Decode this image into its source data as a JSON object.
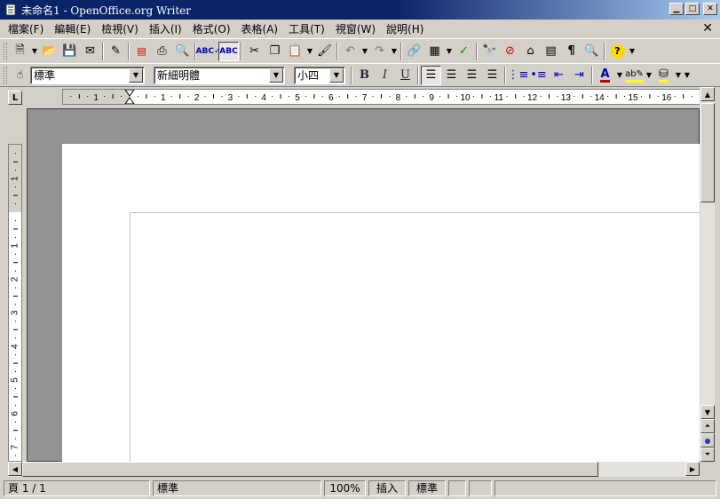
{
  "window": {
    "title": "未命名1 - OpenOffice.org Writer"
  },
  "menu": {
    "items": [
      "檔案(F)",
      "編輯(E)",
      "檢視(V)",
      "插入(I)",
      "格式(O)",
      "表格(A)",
      "工具(T)",
      "視窗(W)",
      "說明(H)"
    ],
    "close_glyph": "✕"
  },
  "format_bar": {
    "paragraph_style": "標準",
    "font_name": "新細明體",
    "font_size": "小四",
    "bold_label": "B",
    "italic_label": "I",
    "underline_label": "U"
  },
  "ruler": {
    "h_ticks": [
      "1",
      "1",
      "2",
      "3",
      "4",
      "5",
      "6",
      "7",
      "8",
      "9",
      "10",
      "11",
      "12",
      "13",
      "14",
      "15",
      "16"
    ],
    "v_ticks": [
      "1",
      "1",
      "2",
      "3",
      "4",
      "5",
      "6",
      "7"
    ]
  },
  "status": {
    "page": "頁 1 / 1",
    "page_style": "標準",
    "zoom": "100%",
    "insert_mode": "插入",
    "selection_mode": "標準"
  },
  "colors": {
    "title_active": "#0a246a",
    "chrome": "#d4d0c8",
    "doc_background": "#939393",
    "font_color": "#c00000",
    "highlight_color": "#ffff00"
  }
}
